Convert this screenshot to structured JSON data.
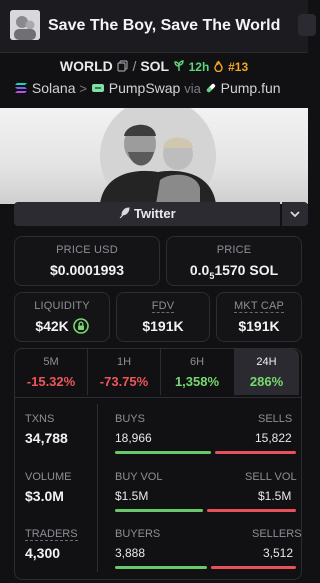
{
  "header": {
    "title": "Save The Boy, Save The World"
  },
  "pair": {
    "base": "WORLD",
    "separator": "/",
    "quote": "SOL",
    "age": "12h",
    "rank": "#13"
  },
  "chain": {
    "network": "Solana",
    "arrow": ">",
    "dex": "PumpSwap",
    "via": "via",
    "launchpad": "Pump.fun"
  },
  "social": {
    "twitter_label": "Twitter"
  },
  "prices": {
    "price_usd_label": "PRICE USD",
    "price_usd": "$0.0001993",
    "price_label": "PRICE",
    "price_sol_prefix": "0.0",
    "price_sol_zeros": "5",
    "price_sol_suffix": "1570 SOL"
  },
  "metrics": {
    "liquidity_label": "LIQUIDITY",
    "liquidity": "$42K",
    "fdv_label": "FDV",
    "fdv": "$191K",
    "mktcap_label": "MKT CAP",
    "mktcap": "$191K"
  },
  "timeframes": [
    {
      "label": "5M",
      "value": "-15.32%",
      "trend": "down"
    },
    {
      "label": "1H",
      "value": "-73.75%",
      "trend": "down"
    },
    {
      "label": "6H",
      "value": "1,358%",
      "trend": "up"
    },
    {
      "label": "24H",
      "value": "286%",
      "trend": "up",
      "active": true
    }
  ],
  "stats": {
    "txns_label": "TXNS",
    "txns": "34,788",
    "buys_label": "BUYS",
    "buys": "18,966",
    "sells_label": "SELLS",
    "sells": "15,822",
    "volume_label": "VOLUME",
    "volume": "$3.0M",
    "buy_vol_label": "BUY VOL",
    "buy_vol": "$1.5M",
    "sell_vol_label": "SELL VOL",
    "sell_vol": "$1.5M",
    "traders_label": "TRADERS",
    "traders": "4,300",
    "buyers_label": "BUYERS",
    "buyers": "3,888",
    "sellers_label": "SELLERS",
    "sellers": "3,512"
  },
  "colors": {
    "positive": "#76d96d",
    "negative": "#f0555a",
    "accent_orange": "#f5a524"
  },
  "icons": [
    "copy-icon",
    "sprout-icon",
    "flame-icon",
    "solana-icon",
    "pumpswap-icon",
    "pumpfun-icon",
    "feather-icon",
    "chevron-down-icon",
    "lock-icon"
  ]
}
